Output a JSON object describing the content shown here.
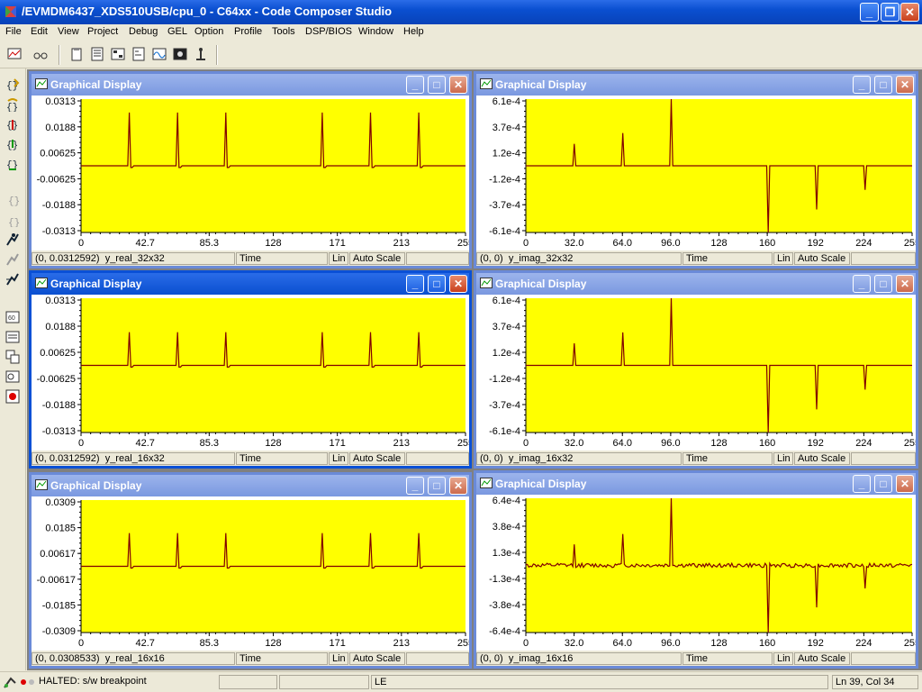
{
  "window": {
    "title": "/EVMDM6437_XDS510USB/cpu_0 - C64xx - Code Composer Studio",
    "controls": [
      "_",
      "❐",
      "✕"
    ]
  },
  "menu": [
    "File",
    "Edit",
    "View",
    "Project",
    "Debug",
    "GEL",
    "Option",
    "Profile",
    "Tools",
    "DSP/BIOS",
    "Window",
    "Help"
  ],
  "toolbar_icons": [
    "graph-icon",
    "glasses-icon",
    "clipboard-icon",
    "memory-icon",
    "registers-icon",
    "disassembly-icon",
    "graph-wave-icon",
    "image-icon",
    "probe-icon"
  ],
  "left_toolbar_icons": [
    "step-into-icon",
    "step-over-icon",
    "step-out-icon",
    "run-to-cursor-icon",
    "set-pc-icon",
    "asm-step-into-icon",
    "asm-step-over-icon",
    "run-icon",
    "halt-icon",
    "animate-icon",
    "watch-icon",
    "memory-window-icon",
    "registers-window-icon",
    "quick-watch-icon",
    "breakpoint-icon"
  ],
  "colors": {
    "plot_bg": "#ffff00",
    "trace": "#800000",
    "titlebar_active": "#0a4fd0",
    "titlebar_inactive": "#7a98e0"
  },
  "panels": [
    {
      "title": "Graphical Display",
      "status": {
        "cursor": "(0, 0.0312592)",
        "signal": "y_real_32x32",
        "time": "Time",
        "scale": "Lin",
        "auto": "Auto Scale"
      },
      "chart_data": {
        "type": "line",
        "xlim": [
          0,
          255
        ],
        "x_ticks": [
          "0",
          "42.7",
          "85.3",
          "128",
          "171",
          "213",
          "255"
        ],
        "ylim": [
          -0.0313,
          0.0313
        ],
        "y_ticks": [
          "0.0313",
          "0.0188",
          "0.00625",
          "-0.00625",
          "-0.0188",
          "-0.0313"
        ],
        "series": [
          {
            "spikes": [
              [
                32,
                0.025
              ],
              [
                64,
                0.025
              ],
              [
                96,
                0.025
              ],
              [
                160,
                0.025
              ],
              [
                192,
                0.025
              ],
              [
                224,
                0.025
              ]
            ],
            "undershoot": -0.0008,
            "noise": 0
          }
        ]
      }
    },
    {
      "title": "Graphical Display",
      "status": {
        "cursor": "(0, 0)",
        "signal": "y_imag_32x32",
        "time": "Time",
        "scale": "Lin",
        "auto": "Auto Scale"
      },
      "chart_data": {
        "type": "line",
        "xlim": [
          0,
          255
        ],
        "x_ticks": [
          "0",
          "32.0",
          "64.0",
          "96.0",
          "128",
          "160",
          "192",
          "224",
          "255"
        ],
        "ylim": [
          -0.00061,
          0.00061
        ],
        "y_ticks": [
          "6.1e-4",
          "3.7e-4",
          "1.2e-4",
          "-1.2e-4",
          "-3.7e-4",
          "-6.1e-4"
        ],
        "series": [
          {
            "spikes": [
              [
                32,
                0.0002
              ],
              [
                64,
                0.0003
              ],
              [
                96,
                0.00061
              ],
              [
                160,
                -0.00061
              ],
              [
                192,
                -0.0004
              ],
              [
                224,
                -0.00022
              ]
            ],
            "undershoot": 0,
            "noise": 0
          }
        ]
      }
    },
    {
      "title": "Graphical Display",
      "status": {
        "cursor": "(0, 0.0312592)",
        "signal": "y_real_16x32",
        "time": "Time",
        "scale": "Lin",
        "auto": "Auto Scale"
      },
      "chart_data": {
        "type": "line",
        "xlim": [
          0,
          255
        ],
        "x_ticks": [
          "0",
          "42.7",
          "85.3",
          "128",
          "171",
          "213",
          "255"
        ],
        "ylim": [
          -0.0313,
          0.0313
        ],
        "y_ticks": [
          "0.0313",
          "0.0188",
          "0.00625",
          "-0.00625",
          "-0.0188",
          "-0.0313"
        ],
        "series": [
          {
            "spikes": [
              [
                32,
                0.0155
              ],
              [
                64,
                0.0155
              ],
              [
                96,
                0.0155
              ],
              [
                160,
                0.0155
              ],
              [
                192,
                0.0155
              ],
              [
                224,
                0.0155
              ]
            ],
            "undershoot": -0.0008,
            "noise": 0
          }
        ]
      }
    },
    {
      "title": "Graphical Display",
      "status": {
        "cursor": "(0, 0)",
        "signal": "y_imag_16x32",
        "time": "Time",
        "scale": "Lin",
        "auto": "Auto Scale"
      },
      "chart_data": {
        "type": "line",
        "xlim": [
          0,
          255
        ],
        "x_ticks": [
          "0",
          "32.0",
          "64.0",
          "96.0",
          "128",
          "160",
          "192",
          "224",
          "255"
        ],
        "ylim": [
          -0.00061,
          0.00061
        ],
        "y_ticks": [
          "6.1e-4",
          "3.7e-4",
          "1.2e-4",
          "-1.2e-4",
          "-3.7e-4",
          "-6.1e-4"
        ],
        "series": [
          {
            "spikes": [
              [
                32,
                0.0002
              ],
              [
                64,
                0.0003
              ],
              [
                96,
                0.00061
              ],
              [
                160,
                -0.00061
              ],
              [
                192,
                -0.0004
              ],
              [
                224,
                -0.00022
              ]
            ],
            "undershoot": 0,
            "noise": 0
          }
        ]
      }
    },
    {
      "title": "Graphical Display",
      "status": {
        "cursor": "(0, 0.0308533)",
        "signal": "y_real_16x16",
        "time": "Time",
        "scale": "Lin",
        "auto": "Auto Scale"
      },
      "chart_data": {
        "type": "line",
        "xlim": [
          0,
          255
        ],
        "x_ticks": [
          "0",
          "42.7",
          "85.3",
          "128",
          "171",
          "213",
          "255"
        ],
        "ylim": [
          -0.0309,
          0.0309
        ],
        "y_ticks": [
          "0.0309",
          "0.0185",
          "0.00617",
          "-0.00617",
          "-0.0185",
          "-0.0309"
        ],
        "series": [
          {
            "spikes": [
              [
                32,
                0.0155
              ],
              [
                64,
                0.0155
              ],
              [
                96,
                0.0155
              ],
              [
                160,
                0.0155
              ],
              [
                192,
                0.0155
              ],
              [
                224,
                0.0155
              ]
            ],
            "undershoot": -0.0008,
            "noise": 0
          }
        ]
      }
    },
    {
      "title": "Graphical Display",
      "status": {
        "cursor": "(0, 0)",
        "signal": "y_imag_16x16",
        "time": "Time",
        "scale": "Lin",
        "auto": "Auto Scale"
      },
      "chart_data": {
        "type": "line",
        "xlim": [
          0,
          255
        ],
        "x_ticks": [
          "0",
          "32.0",
          "64.0",
          "96.0",
          "128",
          "160",
          "192",
          "224",
          "255"
        ],
        "ylim": [
          -0.00064,
          0.00064
        ],
        "y_ticks": [
          "6.4e-4",
          "3.8e-4",
          "1.3e-4",
          "-1.3e-4",
          "-3.8e-4",
          "-6.4e-4"
        ],
        "series": [
          {
            "spikes": [
              [
                32,
                0.0002
              ],
              [
                64,
                0.0003
              ],
              [
                96,
                0.00064
              ],
              [
                160,
                -0.00064
              ],
              [
                192,
                -0.0004
              ],
              [
                224,
                -0.00022
              ]
            ],
            "undershoot": 0,
            "noise": 2e-05
          }
        ]
      }
    }
  ],
  "statusbar": {
    "state": "HALTED: s/w breakpoint",
    "endian": "LE",
    "position": "Ln 39, Col 34"
  }
}
